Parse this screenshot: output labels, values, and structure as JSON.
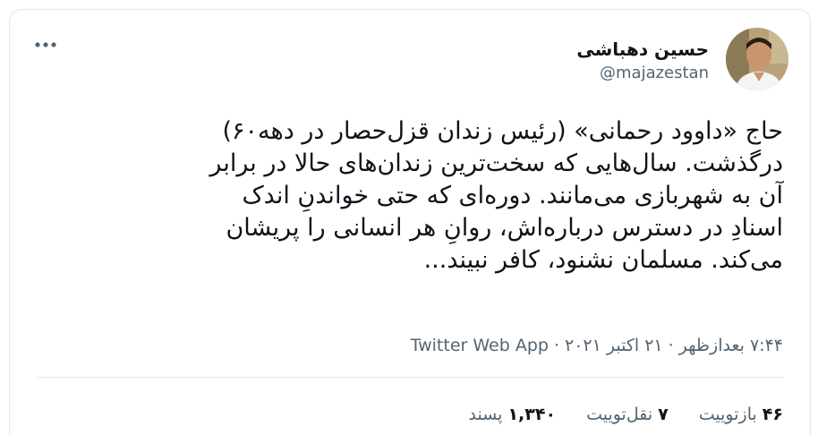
{
  "tweet": {
    "author": {
      "name": "حسین دهباشی",
      "handle": "@majazestan"
    },
    "text_lines": [
      "حاج «داوود رحمانی» (رئیس زندان قزل‌حصار در دهه‌۶۰)",
      "درگذشت. سال‌هایی که سخت‌ترین زندان‌های حالا در برابر",
      "آن به شهربازی می‌مانند. دوره‌ای که حتی خواندنِ اندک",
      "اسنادِ در دسترس درباره‌اش، روانِ هر انسانی را پریشان",
      "می‌کند. مسلمان نشنود، کافر نبیند..."
    ],
    "meta": {
      "time": "۷:۴۴ بعدازظهر",
      "date": "۲۱ اکتبر ۲۰۲۱",
      "separator": "·",
      "source": "Twitter Web App"
    },
    "stats": {
      "retweets_count": "۴۶",
      "retweets_label": "بازتوییت",
      "quotes_count": "۷",
      "quotes_label": "نقل‌توییت",
      "likes_count": "۱,۳۴۰",
      "likes_label": "پسند"
    }
  },
  "icons": {
    "more": "more-horizontal-icon"
  },
  "colors": {
    "text": "#0f1419",
    "secondary": "#536471",
    "border": "#e1e8ed"
  }
}
